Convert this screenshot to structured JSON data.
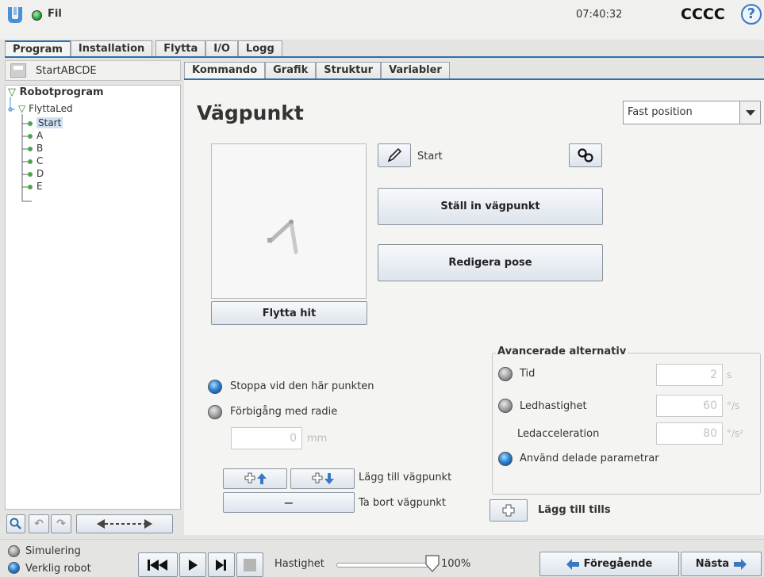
{
  "header": {
    "menu_label": "Fil",
    "clock": "07:40:32",
    "robot_name": "CCCC",
    "help_glyph": "?"
  },
  "main_tabs": [
    {
      "label": "Program",
      "active": true
    },
    {
      "label": "Installation"
    },
    {
      "label": "Flytta"
    },
    {
      "label": "I/O"
    },
    {
      "label": "Logg"
    }
  ],
  "sub_tabs": [
    {
      "label": "Kommando",
      "active": true
    },
    {
      "label": "Grafik"
    },
    {
      "label": "Struktur"
    },
    {
      "label": "Variabler"
    }
  ],
  "program": {
    "file_name": "StartABCDE",
    "tree": {
      "root": "Robotprogram",
      "folder": "FlyttaLed",
      "items": [
        "Start",
        "A",
        "B",
        "C",
        "D",
        "E"
      ],
      "selected": "Start"
    }
  },
  "waypoint": {
    "title": "Vägpunkt",
    "position_type": "Fast position",
    "name": "Start",
    "set_button": "Ställ in vägpunkt",
    "edit_pose_button": "Redigera pose",
    "move_here_button": "Flytta hit",
    "stop_option": "Stoppa vid den här punkten",
    "blend_option": "Förbigång med radie",
    "blend_value": "0",
    "blend_unit": "mm",
    "add_waypoint_label": "Lägg till vägpunkt",
    "remove_waypoint_label": "Ta bort vägpunkt",
    "remove_glyph": "−"
  },
  "advanced": {
    "title": "Avancerade alternativ",
    "time_label": "Tid",
    "time_value": "2",
    "time_unit": "s",
    "joint_speed_label": "Ledhastighet",
    "joint_speed_value": "60",
    "joint_speed_unit": "°/s",
    "joint_accel_label": "Ledacceleration",
    "joint_accel_value": "80",
    "joint_accel_unit": "°/s²",
    "shared_label": "Använd delade parametrar",
    "add_until_label": "Lägg till tills"
  },
  "footer": {
    "simulation": "Simulering",
    "real_robot": "Verklig robot",
    "speed_label": "Hastighet",
    "speed_value": "100%",
    "speed_fraction": 1.0,
    "prev_button": "Föregående",
    "next_button": "Nästa"
  },
  "colors": {
    "accent": "#2e6fa8",
    "logo": "#4a90d9",
    "status_green": "#2ea043",
    "tree_dot": "#4ea34e"
  }
}
